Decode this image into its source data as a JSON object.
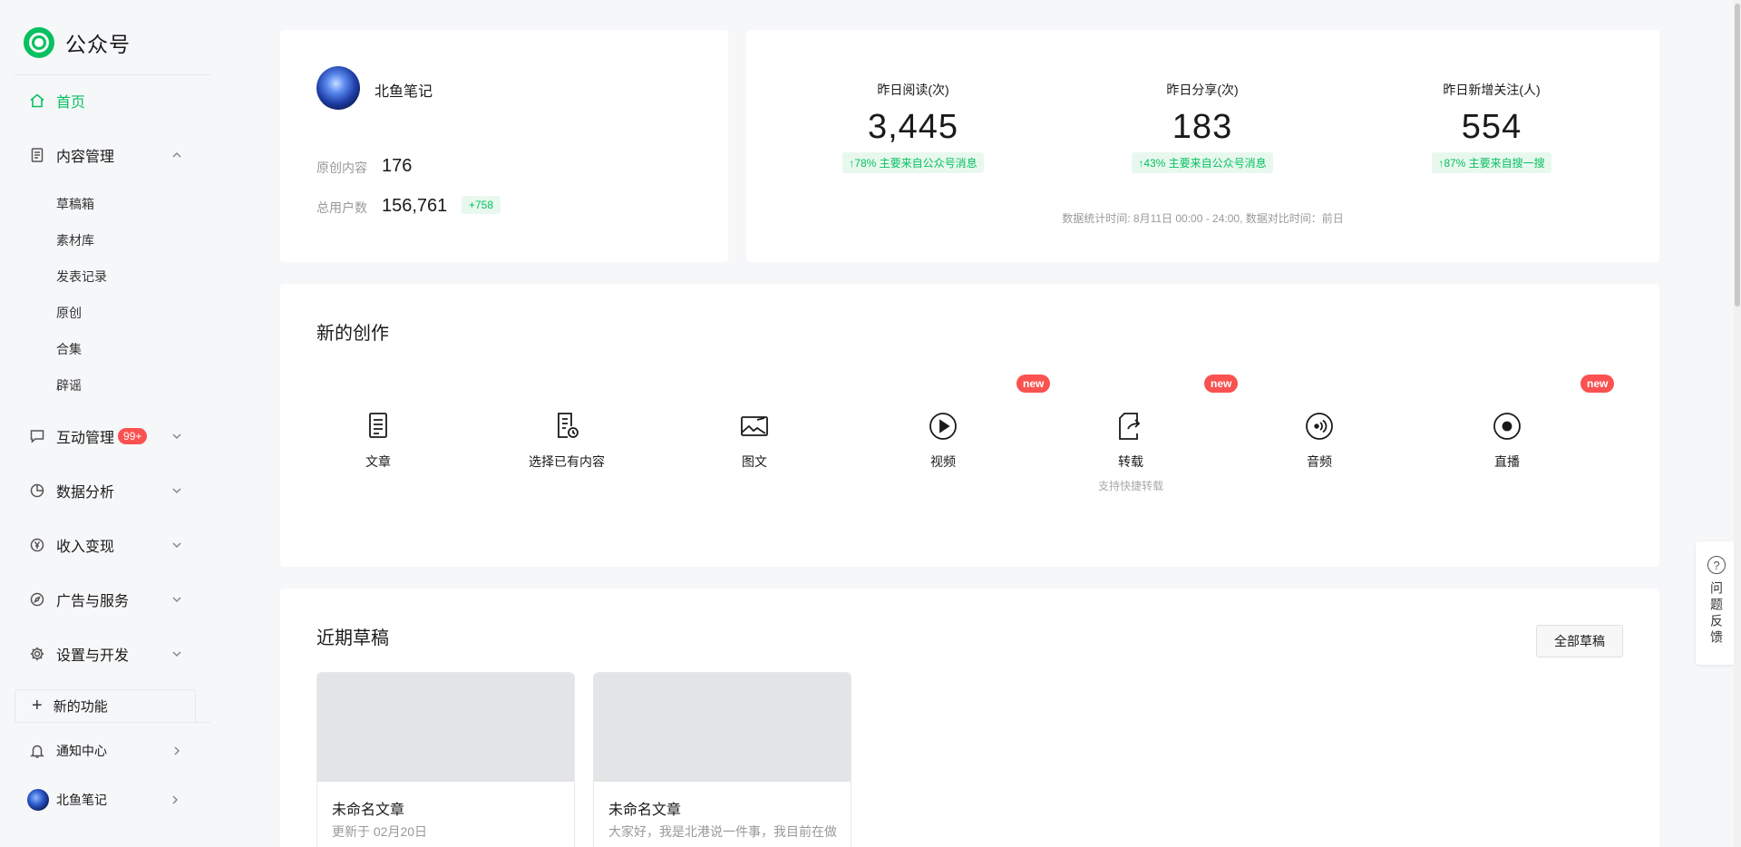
{
  "app": {
    "title": "公众号"
  },
  "sidebar": {
    "home": "首页",
    "content": {
      "label": "内容管理",
      "items": [
        "草稿箱",
        "素材库",
        "发表记录",
        "原创",
        "合集",
        "辟谣"
      ]
    },
    "interaction": {
      "label": "互动管理",
      "badge": "99+"
    },
    "analytics": "数据分析",
    "monetization": "收入变现",
    "ads": "广告与服务",
    "settings": "设置与开发",
    "new_features": "新的功能",
    "notifications": "通知中心",
    "account": "北鱼笔记"
  },
  "account": {
    "name": "北鱼笔记",
    "original_label": "原创内容",
    "original_count": "176",
    "users_label": "总用户数",
    "users_count": "156,761",
    "users_delta": "+758"
  },
  "stats": {
    "items": [
      {
        "label": "昨日阅读(次)",
        "value": "3,445",
        "note": "↑78%   主要来自公众号消息"
      },
      {
        "label": "昨日分享(次)",
        "value": "183",
        "note": "↑43%   主要来自公众号消息"
      },
      {
        "label": "昨日新增关注(人)",
        "value": "554",
        "note": "↑87%   主要来自搜一搜"
      }
    ],
    "footnote": "数据统计时间: 8月11日 00:00 - 24:00, 数据对比时间：前日"
  },
  "create": {
    "title": "新的创作",
    "tools": [
      {
        "label": "文章",
        "icon": "document-icon"
      },
      {
        "label": "选择已有内容",
        "icon": "document-clock-icon"
      },
      {
        "label": "图文",
        "icon": "image-icon"
      },
      {
        "label": "视频",
        "icon": "play-icon",
        "badge": "new"
      },
      {
        "label": "转载",
        "icon": "repost-icon",
        "badge": "new",
        "sub": "支持快捷转载"
      },
      {
        "label": "音频",
        "icon": "audio-icon"
      },
      {
        "label": "直播",
        "icon": "live-icon",
        "badge": "new"
      }
    ]
  },
  "drafts": {
    "title": "近期草稿",
    "all_button": "全部草稿",
    "items": [
      {
        "title": "未命名文章",
        "sub": "更新于 02月20日"
      },
      {
        "title": "未命名文章",
        "sub": "大家好，我是北港说一件事，我目前在做"
      }
    ]
  },
  "feedback": {
    "label": "问题反馈",
    "icon": "?"
  },
  "colors": {
    "accent": "#07c160",
    "badge_red": "#fa5151",
    "page_bg": "#f6f7f9"
  }
}
